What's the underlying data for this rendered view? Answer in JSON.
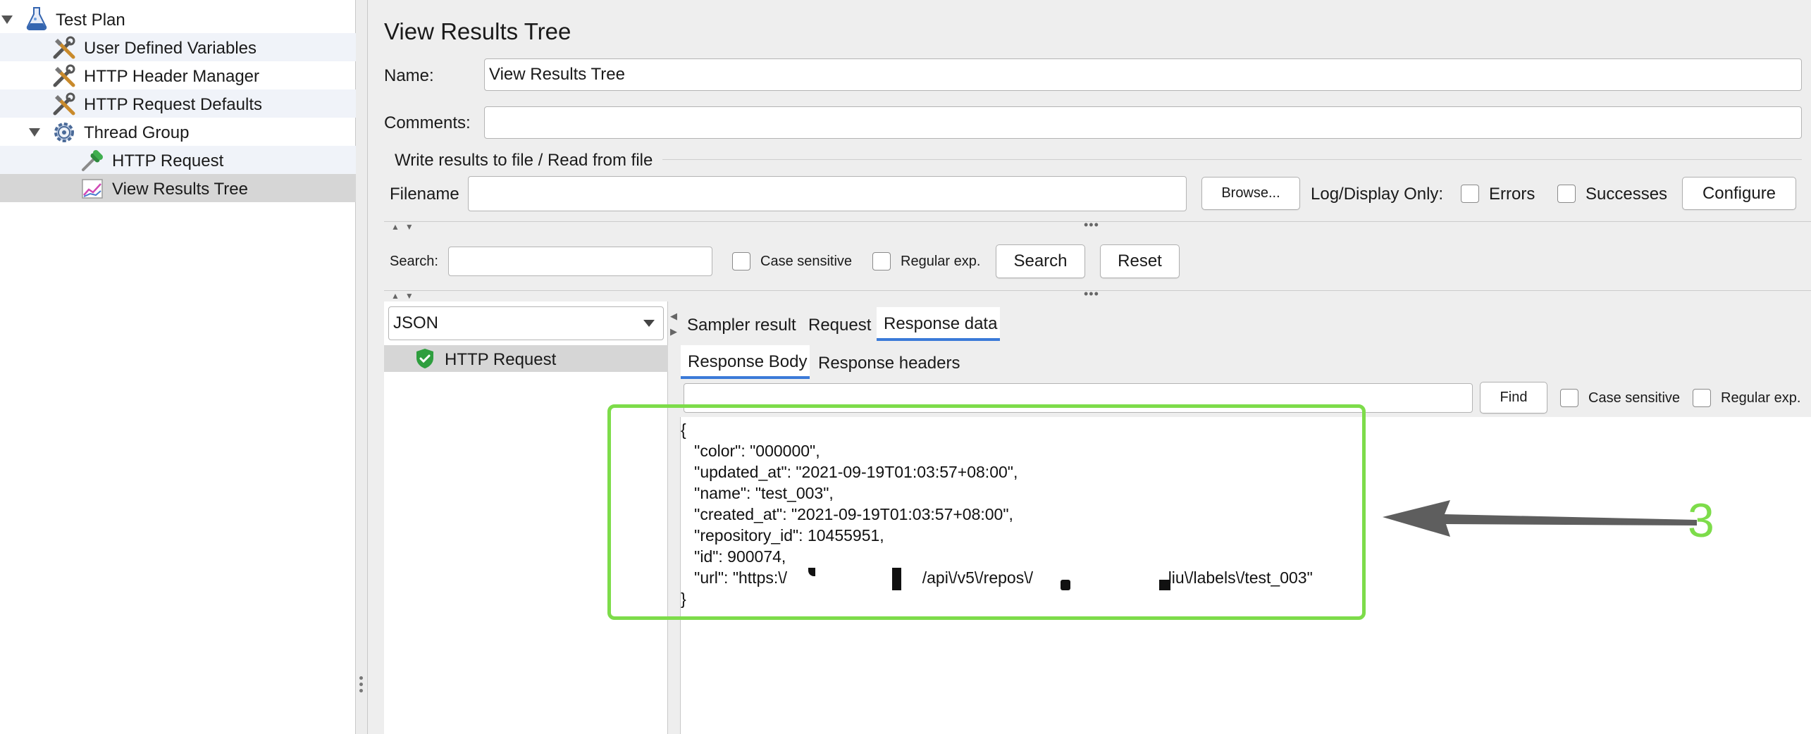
{
  "tree": {
    "items": [
      {
        "label": "Test Plan",
        "icon": "flask-icon"
      },
      {
        "label": "User Defined Variables",
        "icon": "tools-icon"
      },
      {
        "label": "HTTP Header Manager",
        "icon": "tools-icon"
      },
      {
        "label": "HTTP Request Defaults",
        "icon": "tools-icon"
      },
      {
        "label": "Thread Group",
        "icon": "gear-icon"
      },
      {
        "label": "HTTP Request",
        "icon": "pipette-icon"
      },
      {
        "label": "View Results Tree",
        "icon": "graph-icon"
      }
    ]
  },
  "panel": {
    "title": "View Results Tree",
    "name_label": "Name:",
    "name_value": "View Results Tree",
    "comments_label": "Comments:",
    "comments_value": "",
    "file_group_label": "Write results to file / Read from file",
    "filename_label": "Filename",
    "filename_value": "",
    "browse_label": "Browse...",
    "log_display_label": "Log/Display Only:",
    "errors_label": "Errors",
    "successes_label": "Successes",
    "configure_label": "Configure"
  },
  "search": {
    "label": "Search:",
    "value": "",
    "case_sensitive_label": "Case sensitive",
    "regex_label": "Regular exp.",
    "search_button": "Search",
    "reset_button": "Reset"
  },
  "results": {
    "renderer": "JSON",
    "items": [
      {
        "label": "HTTP Request",
        "status": "success"
      }
    ]
  },
  "tabs": {
    "top": [
      "Sampler result",
      "Request",
      "Response data"
    ],
    "active_top": "Response data",
    "sub": [
      "Response Body",
      "Response headers"
    ],
    "active_sub": "Response Body"
  },
  "find": {
    "value": "",
    "button": "Find",
    "case_sensitive_label": "Case sensitive",
    "regex_label": "Regular exp."
  },
  "response_body": {
    "lines": [
      "{",
      "   \"color\": \"000000\",",
      "   \"updated_at\": \"2021-09-19T01:03:57+08:00\",",
      "   \"name\": \"test_003\",",
      "   \"created_at\": \"2021-09-19T01:03:57+08:00\",",
      "   \"repository_id\": 10455951,",
      "   \"id\": 900074,",
      "   \"url\": \"https:\\/                              /api\\/v5\\/repos\\/                              liu\\/labels\\/test_003\"",
      "}"
    ]
  },
  "annotation": {
    "number": "3",
    "color": "#7ddc4a"
  },
  "colors": {
    "accent": "#3b7ad8",
    "success": "#2e9e3e"
  }
}
